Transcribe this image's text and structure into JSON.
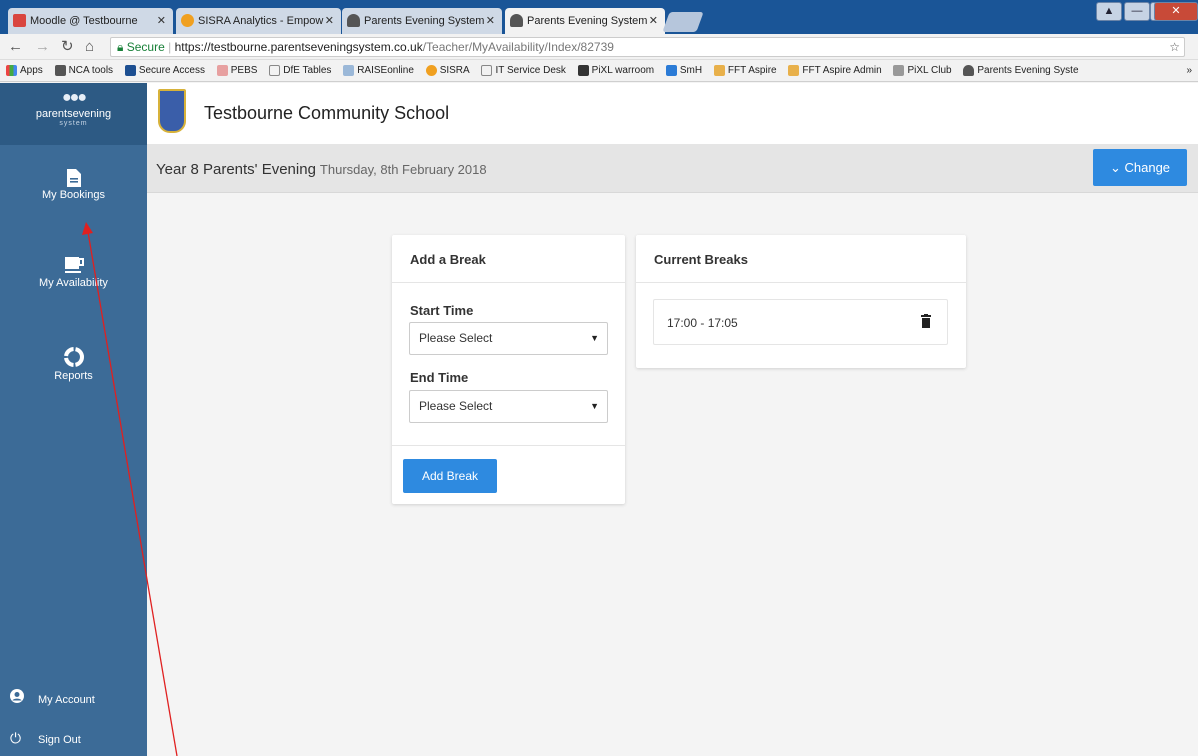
{
  "browser": {
    "tabs": [
      {
        "title": "Moodle @ Testbourne",
        "icon_color": "#d9453f"
      },
      {
        "title": "SISRA Analytics - Empow",
        "icon_color": "#f0a020"
      },
      {
        "title": "Parents Evening System",
        "icon_color": "#333333"
      },
      {
        "title": "Parents Evening System",
        "icon_color": "#333333"
      }
    ],
    "url_secure": "Secure",
    "url_host": "https://testbourne.parentseveningsystem.co.uk",
    "url_path": "/Teacher/MyAvailability/Index/82739",
    "bookmarks": [
      "Apps",
      "NCA tools",
      "Secure Access",
      "PEBS",
      "DfE Tables",
      "RAISEonline",
      "SISRA",
      "IT Service Desk",
      "PiXL warroom",
      "SmH",
      "FFT Aspire",
      "FFT Aspire Admin",
      "PiXL Club",
      "Parents Evening Syste"
    ]
  },
  "sidebar": {
    "logo_text": "parentsevening",
    "logo_sub": "system",
    "items": [
      {
        "label": "My Bookings",
        "icon": "document-icon"
      },
      {
        "label": "My Availability",
        "icon": "cup-icon"
      },
      {
        "label": "Reports",
        "icon": "reports-icon"
      }
    ],
    "footer": [
      {
        "label": "My Account",
        "icon": "user-icon"
      },
      {
        "label": "Sign Out",
        "icon": "power-icon"
      }
    ]
  },
  "header": {
    "school_name": "Testbourne Community School"
  },
  "event": {
    "title": "Year 8 Parents' Evening",
    "date": "Thursday, 8th February 2018",
    "change_label": "Change"
  },
  "add_break": {
    "title": "Add a Break",
    "start_label": "Start Time",
    "start_value": "Please Select",
    "end_label": "End Time",
    "end_value": "Please Select",
    "button_label": "Add Break"
  },
  "current_breaks": {
    "title": "Current Breaks",
    "items": [
      {
        "time": "17:00 - 17:05"
      }
    ]
  },
  "colors": {
    "sidebar": "#3c6b97",
    "accent": "#2e8ae0",
    "annotation": "#e02020"
  }
}
